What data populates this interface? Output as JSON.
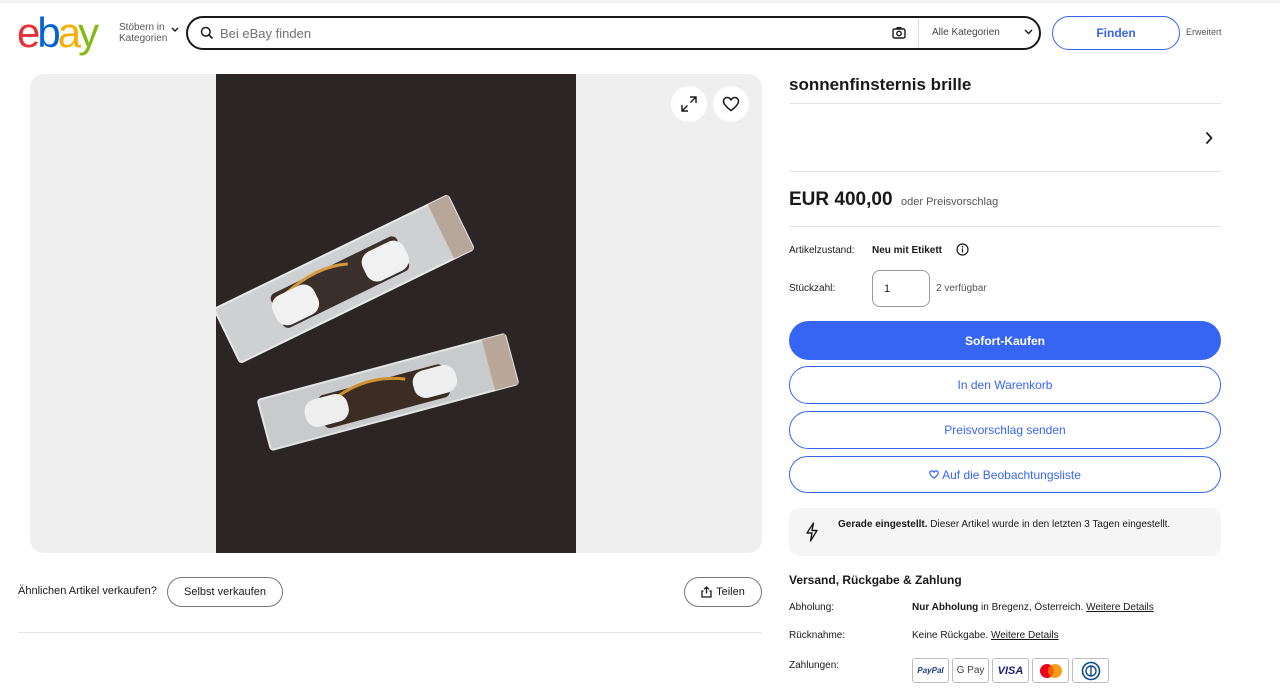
{
  "header": {
    "logo_letters": [
      "e",
      "b",
      "a",
      "y"
    ],
    "browse_line1": "Stöbern in",
    "browse_line2": "Kategorien",
    "search_placeholder": "Bei eBay finden",
    "category_select": "Alle Kategorien",
    "find_label": "Finden",
    "advanced_label": "Erweitert"
  },
  "gallery": {
    "similar_label": "Ähnlichen Artikel verkaufen?",
    "sell_label": "Selbst verkaufen",
    "share_label": "Teilen"
  },
  "item": {
    "title": "sonnenfinsternis brille",
    "price": "EUR 400,00",
    "price_suffix": "oder Preisvorschlag",
    "condition_label": "Artikelzustand:",
    "condition_value": "Neu mit Etikett",
    "quantity_label": "Stückzahl:",
    "quantity_value": "1",
    "quantity_available": "2 verfügbar"
  },
  "actions": {
    "buy_now": "Sofort-Kaufen",
    "add_to_cart": "In den Warenkorb",
    "make_offer": "Preisvorschlag senden",
    "watchlist": "Auf die Beobachtungsliste"
  },
  "notice": {
    "bold": "Gerade eingestellt.",
    "text": " Dieser Artikel wurde in den letzten 3 Tagen eingestellt."
  },
  "shipping": {
    "title": "Versand, Rückgabe & Zahlung",
    "pickup_label": "Abholung:",
    "pickup_bold": "Nur Abholung",
    "pickup_text": " in Bregenz, Österreich. ",
    "pickup_link": "Weitere Details",
    "returns_label": "Rücknahme:",
    "returns_text": "Keine Rückgabe. ",
    "returns_link": "Weitere Details",
    "payments_label": "Zahlungen:",
    "payments": [
      "PayPal",
      "G Pay",
      "VISA",
      "mastercard-icon",
      "diners-icon"
    ]
  },
  "colors": {
    "accent": "#3665f3",
    "logo_e": "#e53238",
    "logo_b": "#0064d2",
    "logo_a": "#f5af02",
    "logo_y": "#86b817"
  }
}
